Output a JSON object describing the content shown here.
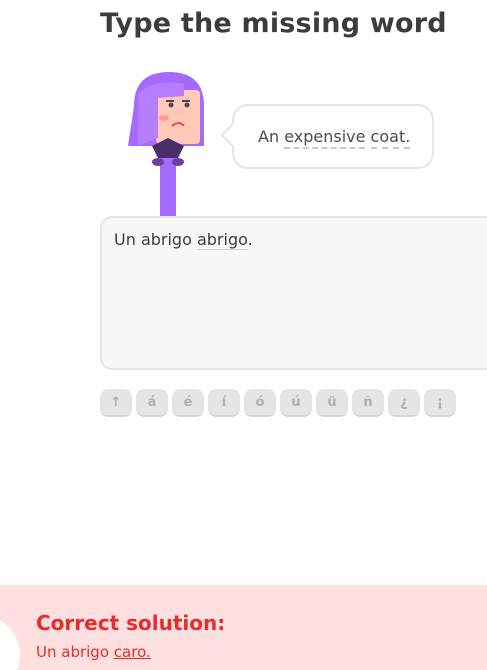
{
  "challenge": {
    "title": "Type the missing word"
  },
  "prompt": {
    "part1": "An",
    "word1": "expensive",
    "word2": "coat."
  },
  "answer": {
    "prefix": "Un abrigo",
    "typed": "abrigo",
    "suffix": "."
  },
  "keyboard": {
    "keys": [
      "↑",
      "á",
      "é",
      "í",
      "ó",
      "ú",
      "ü",
      "ñ",
      "¿",
      "¡"
    ]
  },
  "feedback": {
    "title": "Correct solution:",
    "prefix": "Un abrigo",
    "solution_word": "caro."
  },
  "colors": {
    "error_text": "#ea2b2b",
    "error_bg": "#ffdfe0",
    "character_purple": "#a56bff"
  }
}
